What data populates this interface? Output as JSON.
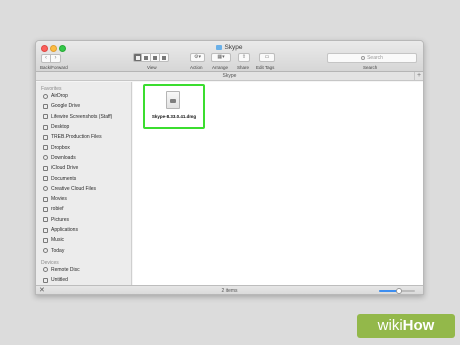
{
  "window": {
    "title": "Skype",
    "toolbar": {
      "nav_back_glyph": "‹",
      "nav_forward_glyph": "›",
      "back_forward_label": "Back/Forward",
      "view_label": "View",
      "action_label": "Action",
      "arrange_label": "Arrange",
      "share_label": "Share",
      "edit_tags_label": "Edit Tags",
      "search_label": "Search",
      "search_placeholder": "Search"
    },
    "path_bar": {
      "label": "Skype",
      "add_glyph": "+"
    }
  },
  "sidebar": {
    "favorites_header": "Favorites",
    "favorites": [
      {
        "label": "AirDrop",
        "icon": "airdrop-icon"
      },
      {
        "label": "Google Drive",
        "icon": "folder-icon"
      },
      {
        "label": "Lifewire Screenshots (Staff)",
        "icon": "folder-icon"
      },
      {
        "label": "Desktop",
        "icon": "desktop-icon"
      },
      {
        "label": "TREB.Production Files",
        "icon": "folder-icon"
      },
      {
        "label": "Dropbox",
        "icon": "dropbox-icon"
      },
      {
        "label": "Downloads",
        "icon": "downloads-icon"
      },
      {
        "label": "iCloud Drive",
        "icon": "cloud-icon"
      },
      {
        "label": "Documents",
        "icon": "documents-icon"
      },
      {
        "label": "Creative Cloud Files",
        "icon": "creative-cloud-icon"
      },
      {
        "label": "Movies",
        "icon": "movies-icon"
      },
      {
        "label": "robief",
        "icon": "home-icon"
      },
      {
        "label": "Pictures",
        "icon": "pictures-icon"
      },
      {
        "label": "Applications",
        "icon": "applications-icon"
      },
      {
        "label": "Music",
        "icon": "music-icon"
      },
      {
        "label": "Today",
        "icon": "clock-icon"
      }
    ],
    "devices_header": "Devices",
    "devices": [
      {
        "label": "Remote Disc",
        "icon": "disc-icon"
      },
      {
        "label": "Untitled",
        "icon": "drive-icon"
      }
    ]
  },
  "content": {
    "files": [
      {
        "name": "Skype-8.33.0.41.dmg",
        "icon": "dmg-file-icon",
        "selected": true
      }
    ]
  },
  "status_bar": {
    "close_glyph": "✕",
    "item_count": "2 items",
    "zoom_level": 0.55
  },
  "watermark": {
    "part1": "wiki",
    "part2": "How"
  },
  "colors": {
    "selection_highlight": "#3bdd2f",
    "watermark_bg": "#93b84a",
    "traffic_close": "#fc605c",
    "traffic_minimize": "#fdbc40",
    "traffic_maximize": "#34c84a"
  }
}
